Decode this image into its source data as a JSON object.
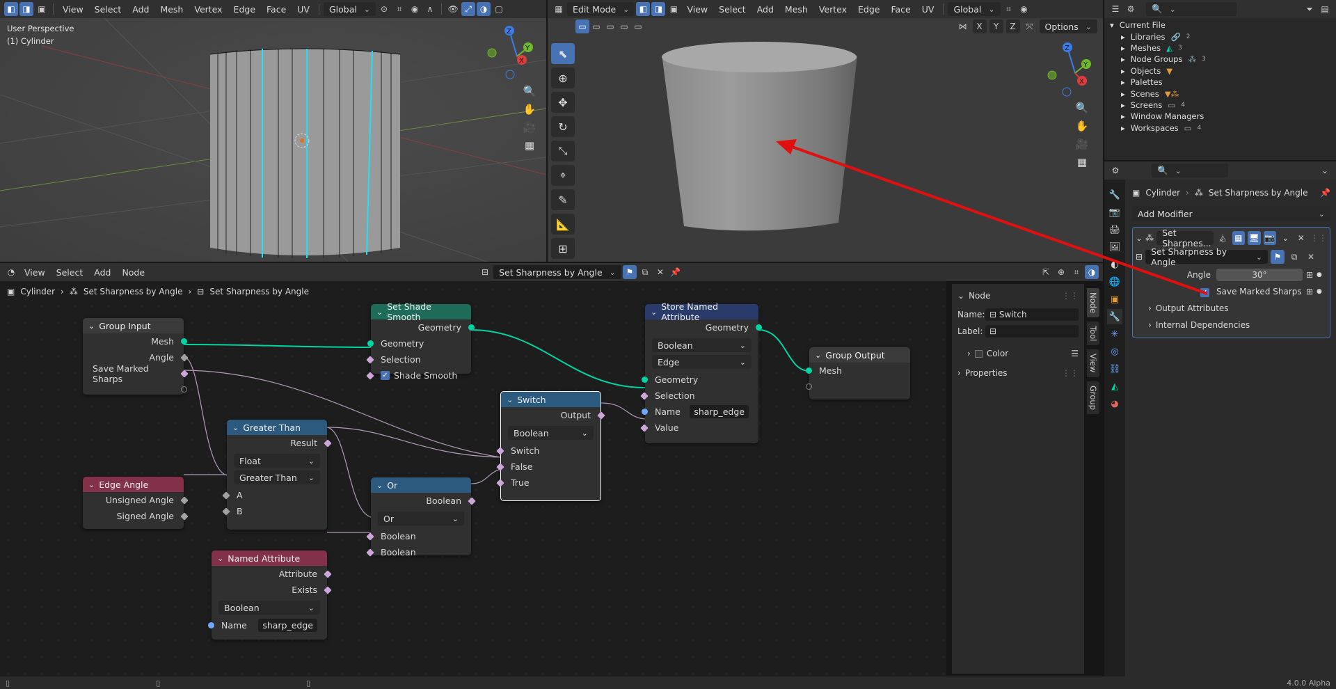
{
  "viewport1": {
    "menu": [
      "View",
      "Select",
      "Add",
      "Mesh",
      "Vertex",
      "Edge",
      "Face",
      "UV"
    ],
    "transform_orientation": "Global",
    "title": "User Perspective",
    "object_label": "(1) Cylinder"
  },
  "viewport2": {
    "mode": "Edit Mode",
    "menu": [
      "View",
      "Select",
      "Add",
      "Mesh",
      "Vertex",
      "Edge",
      "Face",
      "UV"
    ],
    "transform_orientation": "Global",
    "axes": [
      "X",
      "Y",
      "Z"
    ],
    "options_label": "Options"
  },
  "gizmo": {
    "x": "X",
    "y": "Y",
    "z": "Z"
  },
  "node_editor": {
    "menu": [
      "View",
      "Select",
      "Add",
      "Node"
    ],
    "node_group": "Set Sharpness by Angle",
    "breadcrumb": [
      "Cylinder",
      "Set Sharpness by Angle",
      "Set Sharpness by Angle"
    ],
    "nodes": {
      "group_input": {
        "title": "Group Input",
        "outputs": [
          "Mesh",
          "Angle",
          "Save Marked Sharps"
        ]
      },
      "edge_angle": {
        "title": "Edge Angle",
        "outputs": [
          "Unsigned Angle",
          "Signed Angle"
        ]
      },
      "greater_than": {
        "title": "Greater Than",
        "output": "Result",
        "type": "Float",
        "op": "Greater Than",
        "inputs": [
          "A",
          "B"
        ]
      },
      "named_attribute": {
        "title": "Named Attribute",
        "outputs": [
          "Attribute",
          "Exists"
        ],
        "type": "Boolean",
        "name_label": "Name",
        "name_value": "sharp_edge"
      },
      "set_shade_smooth": {
        "title": "Set Shade Smooth",
        "output": "Geometry",
        "inputs": [
          "Geometry",
          "Selection",
          "Shade Smooth"
        ]
      },
      "or": {
        "title": "Or",
        "output": "Boolean",
        "op": "Or",
        "inputs": [
          "Boolean",
          "Boolean"
        ]
      },
      "switch": {
        "title": "Switch",
        "output": "Output",
        "type": "Boolean",
        "inputs": [
          "Switch",
          "False",
          "True"
        ]
      },
      "store_named_attribute": {
        "title": "Store Named Attribute",
        "output": "Geometry",
        "type": "Boolean",
        "domain": "Edge",
        "inputs": [
          "Geometry",
          "Selection",
          "Name",
          "Value"
        ],
        "name_value": "sharp_edge"
      },
      "group_output": {
        "title": "Group Output",
        "inputs": [
          "Mesh"
        ]
      }
    },
    "sidebar": {
      "section": "Node",
      "name_label": "Name:",
      "name_value": "Switch",
      "label_label": "Label:",
      "label_value": "",
      "color_label": "Color",
      "properties_label": "Properties",
      "tabs": [
        "Node",
        "Tool",
        "View",
        "Group"
      ]
    }
  },
  "outliner": {
    "root": "Current File",
    "items": [
      {
        "label": "Libraries",
        "count": "2"
      },
      {
        "label": "Meshes",
        "count": "3"
      },
      {
        "label": "Node Groups",
        "count": "3"
      },
      {
        "label": "Objects",
        "count": ""
      },
      {
        "label": "Palettes",
        "count": ""
      },
      {
        "label": "Scenes",
        "count": ""
      },
      {
        "label": "Screens",
        "count": "4"
      },
      {
        "label": "Window Managers",
        "count": ""
      },
      {
        "label": "Workspaces",
        "count": "4"
      }
    ]
  },
  "properties": {
    "breadcrumb": [
      "Cylinder",
      "Set Sharpness by Angle"
    ],
    "add_modifier": "Add Modifier",
    "modifier_name": "Set Sharpnes...",
    "node_group": "Set Sharpness by Angle",
    "angle_label": "Angle",
    "angle_value": "30°",
    "save_marked_label": "Save Marked Sharps",
    "output_attributes": "Output Attributes",
    "internal_dependencies": "Internal Dependencies"
  },
  "status_bar": {
    "version": "4.0.0 Alpha"
  },
  "colors": {
    "accent": "#4772b3",
    "geometry_socket": "#00d6a3",
    "annotation_arrow": "#e01010",
    "function_node": "#2c5a7f",
    "attribute_node": "#83314a",
    "geometry_node": "#1f6b5a",
    "output_node": "#3b3b3b",
    "store_node": "#293b6b"
  }
}
